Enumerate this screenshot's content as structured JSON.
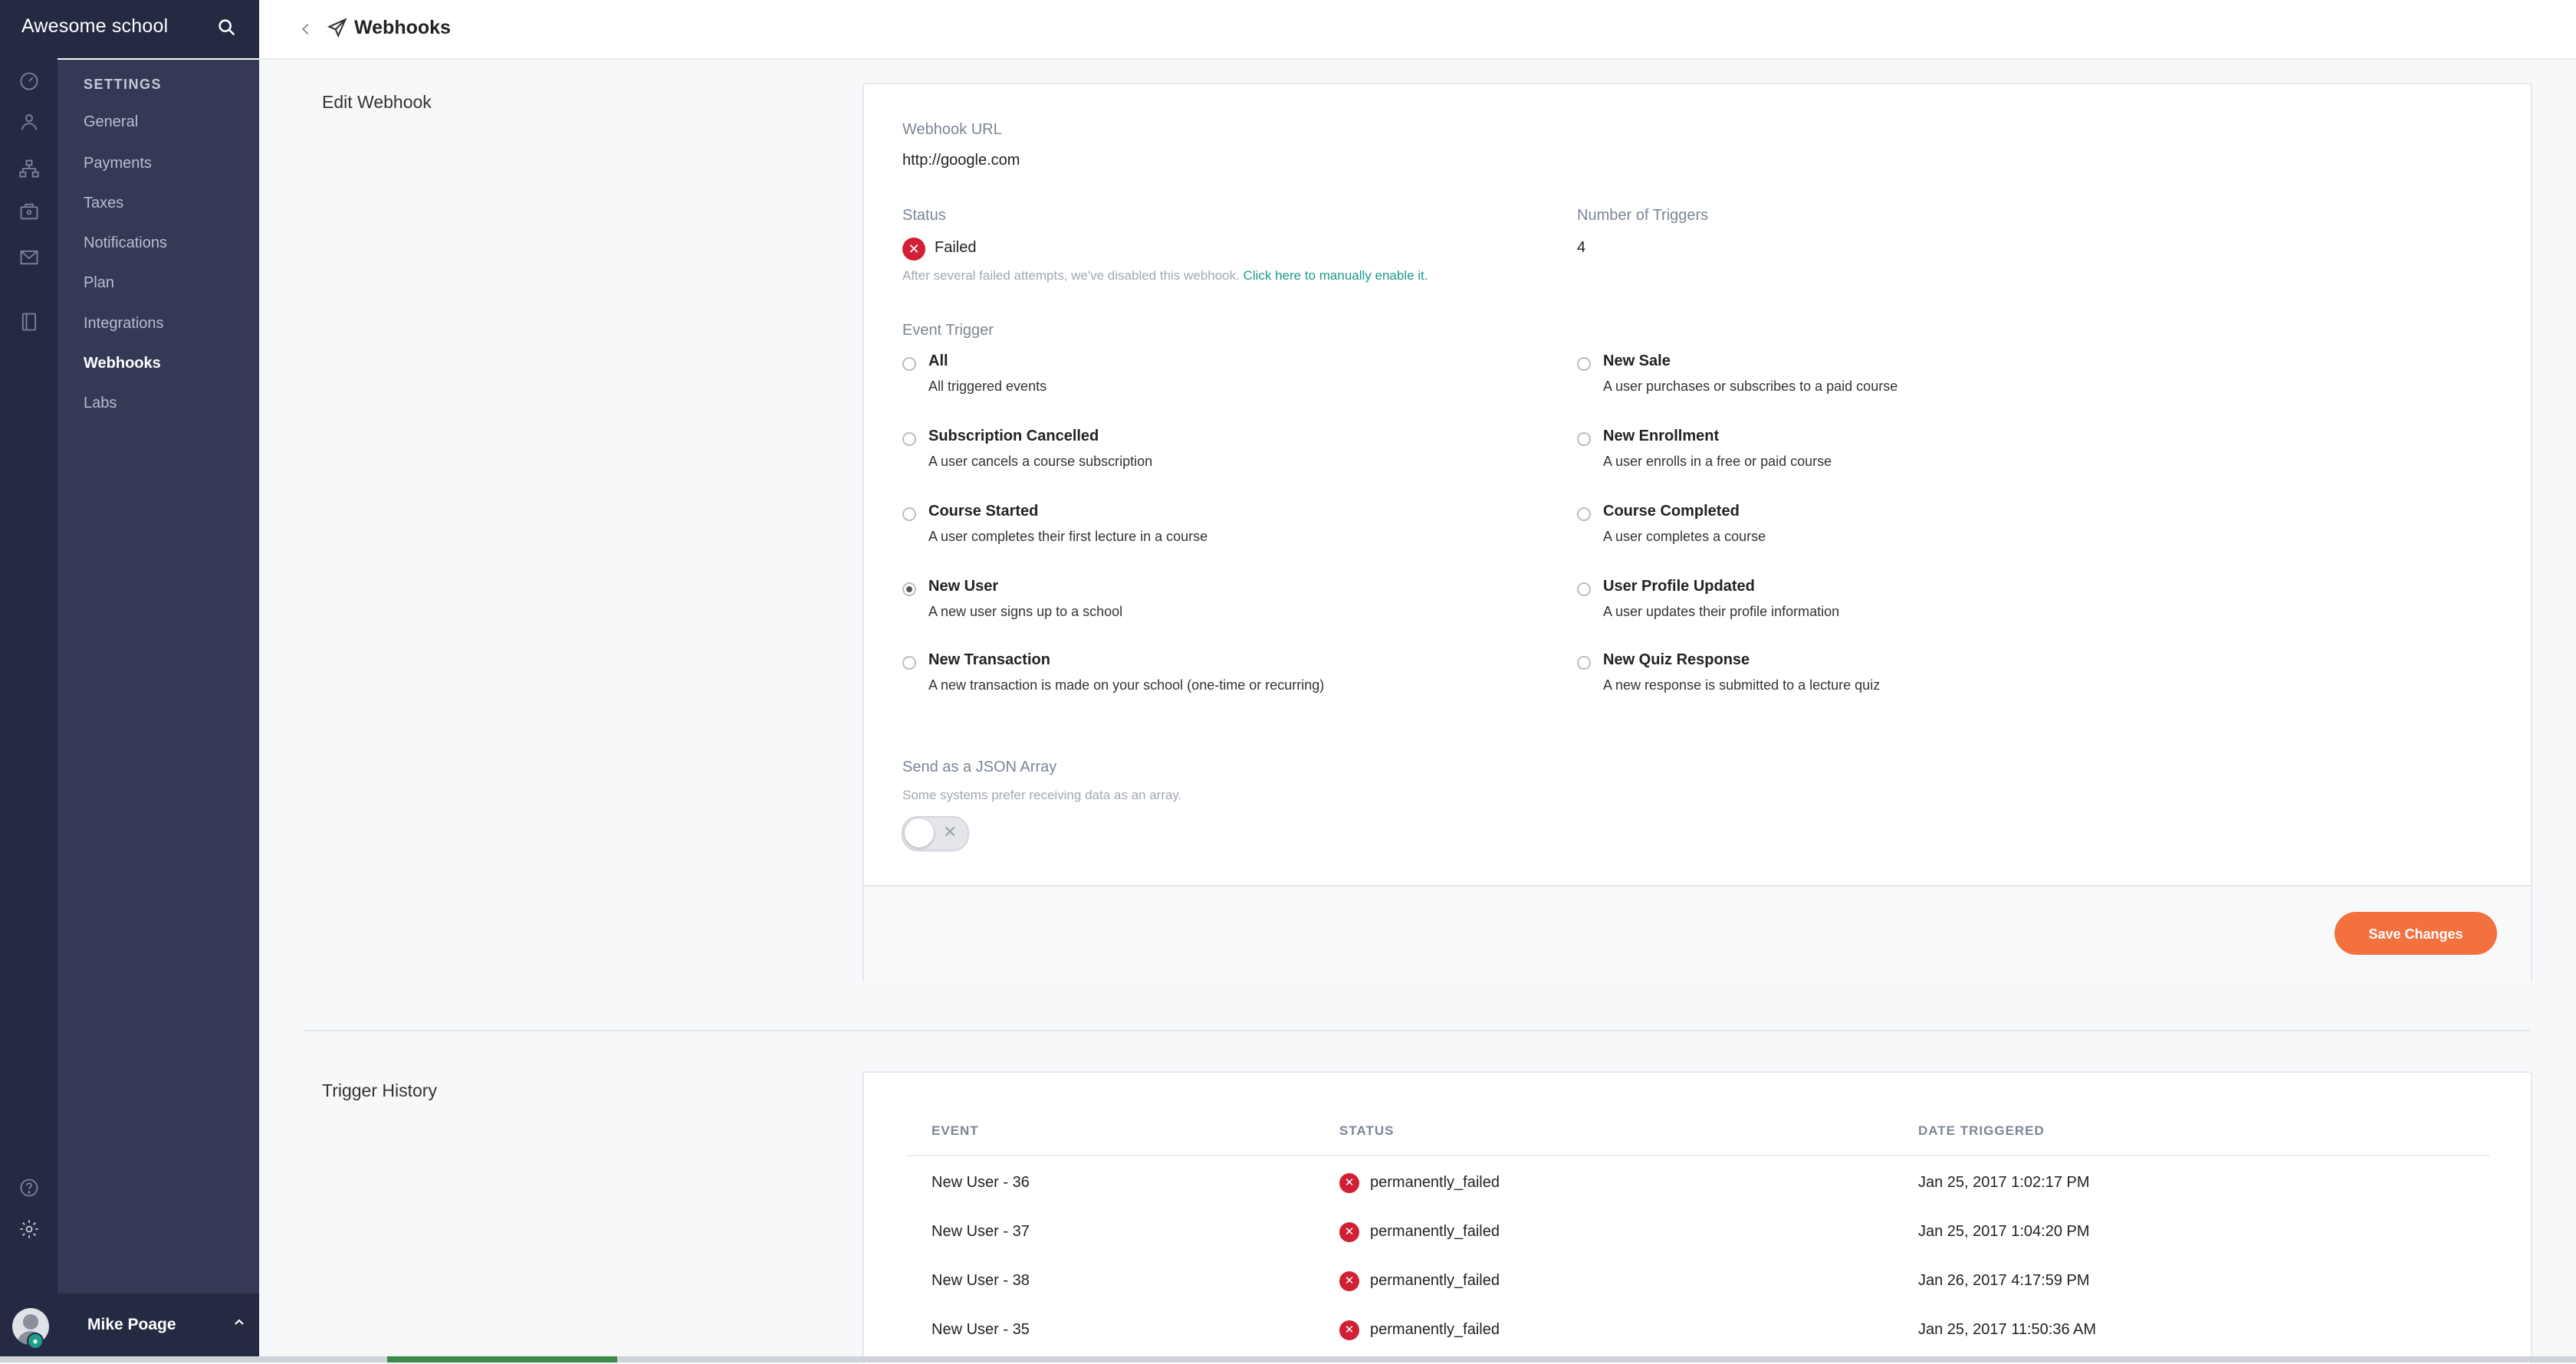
{
  "app": {
    "school_name": "Awesome school",
    "page_title": "Webhooks"
  },
  "sidebar": {
    "section_title": "SETTINGS",
    "items": [
      {
        "label": "General"
      },
      {
        "label": "Payments"
      },
      {
        "label": "Taxes"
      },
      {
        "label": "Notifications"
      },
      {
        "label": "Plan"
      },
      {
        "label": "Integrations"
      },
      {
        "label": "Webhooks",
        "active": true
      },
      {
        "label": "Labs"
      }
    ]
  },
  "rail_icons": [
    "dashboard-icon",
    "users-icon",
    "sitemap-icon",
    "sales-icon",
    "mail-icon",
    "book-icon",
    "help-icon",
    "settings-icon"
  ],
  "user": {
    "name": "Mike Poage"
  },
  "edit_webhook": {
    "section_label": "Edit Webhook",
    "url_label": "Webhook URL",
    "url_value": "http://google.com",
    "status_label": "Status",
    "status_value": "Failed",
    "status_hint": "After several failed attempts, we've disabled this webhook. ",
    "status_link": "Click here to manually enable it.",
    "triggers_label": "Number of Triggers",
    "triggers_value": "4",
    "event_trigger_label": "Event Trigger",
    "events": [
      {
        "title": "All",
        "desc": "All triggered events",
        "checked": false
      },
      {
        "title": "New Sale",
        "desc": "A user purchases or subscribes to a paid course",
        "checked": false
      },
      {
        "title": "Subscription Cancelled",
        "desc": "A user cancels a course subscription",
        "checked": false
      },
      {
        "title": "New Enrollment",
        "desc": "A user enrolls in a free or paid course",
        "checked": false
      },
      {
        "title": "Course Started",
        "desc": "A user completes their first lecture in a course",
        "checked": false
      },
      {
        "title": "Course Completed",
        "desc": "A user completes a course",
        "checked": false
      },
      {
        "title": "New User",
        "desc": "A new user signs up to a school",
        "checked": true
      },
      {
        "title": "User Profile Updated",
        "desc": "A user updates their profile information",
        "checked": false
      },
      {
        "title": "New Transaction",
        "desc": "A new transaction is made on your school (one-time or recurring)",
        "checked": false
      },
      {
        "title": "New Quiz Response",
        "desc": "A new response is submitted to a lecture quiz",
        "checked": false
      }
    ],
    "json_array_label": "Send as a JSON Array",
    "json_array_hint": "Some systems prefer receiving data as an array.",
    "json_array_enabled": false,
    "save_label": "Save Changes"
  },
  "trigger_history": {
    "section_label": "Trigger History",
    "columns": [
      "EVENT",
      "STATUS",
      "DATE TRIGGERED"
    ],
    "rows": [
      {
        "event": "New User - 36",
        "status": "permanently_failed",
        "date": "Jan 25, 2017 1:02:17 PM"
      },
      {
        "event": "New User - 37",
        "status": "permanently_failed",
        "date": "Jan 25, 2017 1:04:20 PM"
      },
      {
        "event": "New User - 38",
        "status": "permanently_failed",
        "date": "Jan 26, 2017 4:17:59 PM"
      },
      {
        "event": "New User - 35",
        "status": "permanently_failed",
        "date": "Jan 25, 2017 11:50:36 AM"
      }
    ]
  },
  "colors": {
    "rail": "#242a42",
    "submenu": "#343a56",
    "accent": "#f4703f",
    "link": "#1d9a8b",
    "error": "#d12033"
  }
}
